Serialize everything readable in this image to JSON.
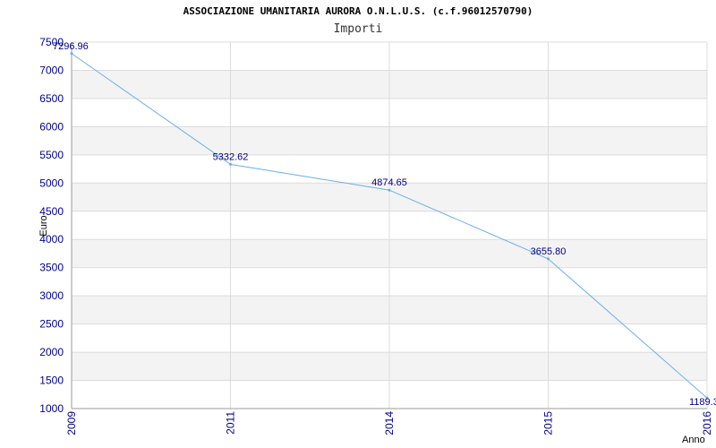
{
  "title": "ASSOCIAZIONE UMANITARIA AURORA O.N.L.U.S. (c.f.96012570790)",
  "subtitle": "Importi",
  "colors": {
    "line": "#6aaeea",
    "axis_text": "#00008b",
    "data_label": "#000080",
    "band_fill": "#f3f3f3",
    "grid": "#dcdcdc"
  },
  "chart_data": {
    "type": "line",
    "title": "ASSOCIAZIONE UMANITARIA AURORA O.N.L.U.S. (c.f.96012570790)",
    "subtitle": "Importi",
    "xlabel": "Anno",
    "ylabel": "Euro",
    "categories": [
      "2009",
      "2011",
      "2014",
      "2015",
      "2016"
    ],
    "values": [
      7296.96,
      5332.62,
      4874.65,
      3655.8,
      1189.3
    ],
    "data_labels": [
      "7296.96",
      "5332.62",
      "4874.65",
      "3655.80",
      "1189.3"
    ],
    "yticks": [
      1000,
      1500,
      2000,
      2500,
      3000,
      3500,
      4000,
      4500,
      5000,
      5500,
      6000,
      6500,
      7000,
      7500
    ],
    "ylim": [
      1000,
      7500
    ],
    "grid": true,
    "legend": "none"
  }
}
